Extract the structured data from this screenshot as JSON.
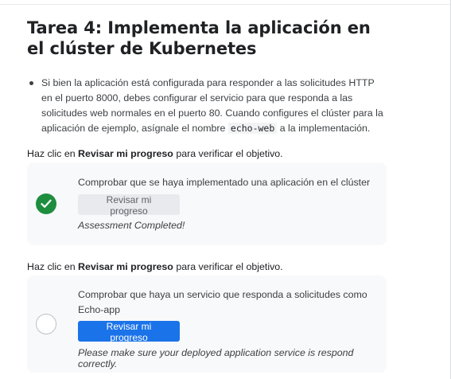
{
  "task": {
    "title": "Tarea 4: Implementa la aplicación en el clúster de Kubernetes",
    "bullet_before": "Si bien la aplicación está configurada para responder a las solicitudes HTTP en el puerto 8000, debes configurar el servicio para que responda a las solicitudes web normales en el puerto 80. Cuando configures el clúster para la aplicación de ejemplo, asígnale el nombre ",
    "bullet_code": "echo-web",
    "bullet_after": " a la implementación."
  },
  "checks": [
    {
      "instruction_prefix": "Haz clic en ",
      "instruction_bold": "Revisar mi progreso",
      "instruction_suffix": " para verificar el objetivo.",
      "description": "Comprobar que se haya implementado una aplicación en el clúster",
      "button_label": "Revisar mi progreso",
      "button_state": "disabled",
      "status_icon": "check-circle-icon",
      "result": "Assessment Completed!"
    },
    {
      "instruction_prefix": "Haz clic en ",
      "instruction_bold": "Revisar mi progreso",
      "instruction_suffix": " para verificar el objetivo.",
      "description": "Comprobar que haya un servicio que responda a solicitudes como Echo-app",
      "button_label": "Revisar mi progreso",
      "button_state": "enabled",
      "status_icon": "empty-circle-icon",
      "result": "Please make sure your deployed application service is respond correctly."
    }
  ],
  "colors": {
    "success": "#1e8e3e",
    "primary_button": "#1a73e8",
    "card_background": "#f8f9fa"
  }
}
